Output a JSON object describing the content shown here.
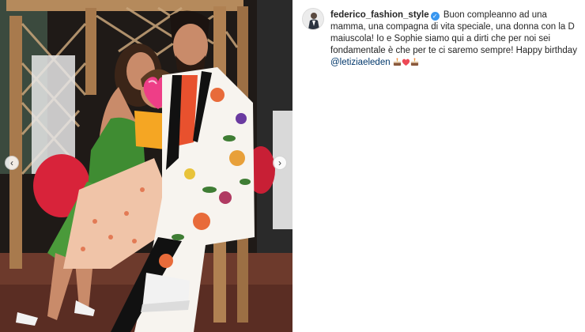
{
  "post": {
    "author": {
      "username": "federico_fashion_style",
      "verified": true
    },
    "caption": {
      "text": "Buon compleanno ad una mamma, una compagna di vita speciale, una donna con la D maiuscola! Io e Sophie siamo qui a dirti che per noi sei fondamentale è che per te ci saremo sempre! Happy birthday",
      "mention": "@letiziaeleden",
      "emojis": [
        "cake-emoji",
        "red-heart-emoji",
        "cake-emoji"
      ]
    }
  },
  "media": {
    "carousel": {
      "prev_icon": "chevron-left-icon",
      "next_icon": "chevron-right-icon"
    }
  },
  "colors": {
    "verified": "#3897f0",
    "mention": "#00376b",
    "text": "#262626",
    "heart": "#ed4956"
  }
}
